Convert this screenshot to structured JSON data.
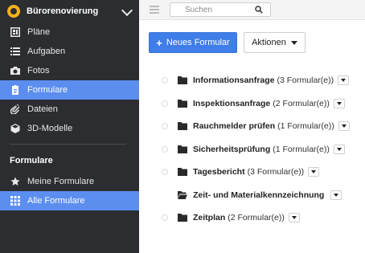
{
  "sidebar": {
    "project_name": "Bürorenovierung",
    "nav_items": [
      {
        "label": "Pläne",
        "icon": "plans-icon"
      },
      {
        "label": "Aufgaben",
        "icon": "list-icon"
      },
      {
        "label": "Fotos",
        "icon": "camera-icon"
      },
      {
        "label": "Formulare",
        "icon": "clipboard-icon",
        "active": true
      },
      {
        "label": "Dateien",
        "icon": "paperclip-icon"
      },
      {
        "label": "3D-Modelle",
        "icon": "cube-icon"
      }
    ],
    "section_title": "Formulare",
    "section_items": [
      {
        "label": "Meine Formulare",
        "icon": "star-icon"
      },
      {
        "label": "Alle Formulare",
        "icon": "grid-icon",
        "active": true
      }
    ]
  },
  "topbar": {
    "search_placeholder": "Suchen"
  },
  "toolbar": {
    "new_form_label": "Neues Formular",
    "actions_label": "Aktionen"
  },
  "folders": [
    {
      "name": "Informationsanfrage",
      "count": "(3 Formular(e))"
    },
    {
      "name": "Inspektionsanfrage",
      "count": "(2 Formular(e))"
    },
    {
      "name": "Rauchmelder prüfen",
      "count": "(1 Formular(e))"
    },
    {
      "name": "Sicherheitsprüfung",
      "count": "(1 Formular(e))"
    },
    {
      "name": "Tagesbericht",
      "count": "(3 Formular(e))"
    },
    {
      "name": "Zeit- und Materialkennzeichnung",
      "count": ""
    },
    {
      "name": "Zeitplan",
      "count": "(2 Formular(e))"
    }
  ],
  "colors": {
    "sidebar_bg": "#2c2d31",
    "active_bg": "#5c8ef0",
    "primary_button": "#3f7ee8",
    "logo": "#f2b21b"
  }
}
